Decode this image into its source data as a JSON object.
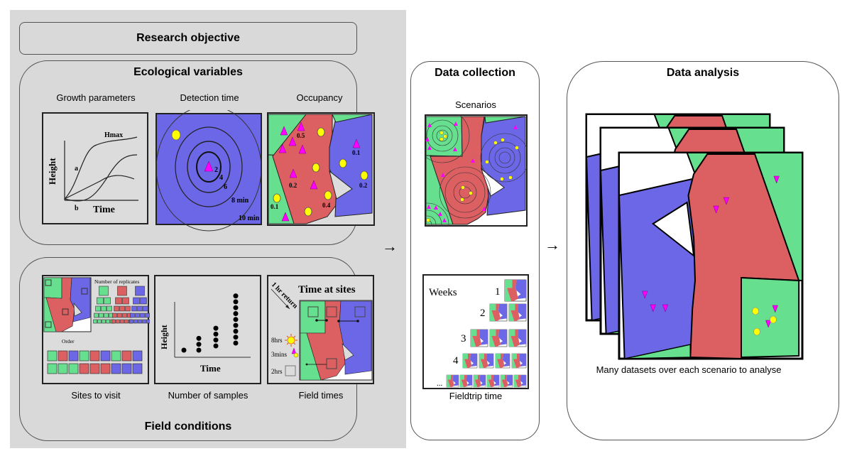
{
  "colors": {
    "panel_bg": "#d9d9d9",
    "green": "#66e08f",
    "red": "#dc5f62",
    "blue": "#6b67e6",
    "yellow": "#ffff00",
    "magenta": "#ff00ff"
  },
  "research_objective": {
    "title": "Research objective"
  },
  "ecological_variables": {
    "title": "Ecological variables",
    "panels": [
      {
        "caption": "Growth parameters",
        "xlabel": "Time",
        "ylabel": "Height",
        "labels": {
          "hmax": "Hmax",
          "a": "a",
          "b": "b"
        }
      },
      {
        "caption": "Detection time",
        "ring_labels": [
          "2",
          "4",
          "6",
          "8 min",
          "10 min"
        ]
      },
      {
        "caption": "Occupancy",
        "values": [
          "0.5",
          "0.1",
          "0.2",
          "0.2",
          "0.4",
          "0.1"
        ]
      }
    ]
  },
  "field_conditions": {
    "title": "Field conditions",
    "panels": [
      {
        "caption": "Sites to visit",
        "replicates_label": "Number of replicates",
        "order_label": "Order"
      },
      {
        "caption": "Number of samples",
        "xlabel": "Time",
        "ylabel": "Height",
        "sample_counts": [
          1,
          3,
          4,
          9
        ]
      },
      {
        "caption": "Field times",
        "heading": "Time at sites",
        "return_label": "1 hr return",
        "legend": [
          {
            "label": "8hrs",
            "icon": "sun-icon"
          },
          {
            "label": "3mins",
            "icon": "triangle-circle-icon"
          },
          {
            "label": "2hrs",
            "icon": "square-icon"
          }
        ]
      }
    ]
  },
  "data_collection": {
    "title": "Data collection",
    "scenarios_label": "Scenarios",
    "fieldtrip": {
      "weeks_label": "Weeks",
      "rows": [
        {
          "label": "1",
          "count": 1
        },
        {
          "label": "2",
          "count": 2
        },
        {
          "label": "3",
          "count": 3
        },
        {
          "label": "4",
          "count": 4
        },
        {
          "label": "...",
          "count": 6
        }
      ],
      "caption": "Fieldtrip time"
    }
  },
  "data_analysis": {
    "title": "Data analysis",
    "caption": "Many datasets over each scenario to analyse"
  },
  "arrows": {
    "symbol": "→"
  }
}
